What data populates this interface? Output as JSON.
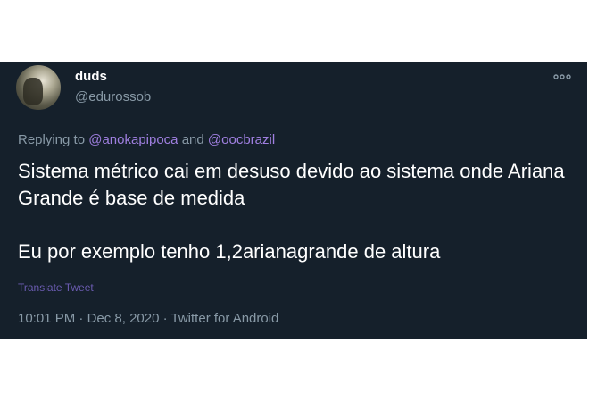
{
  "tweet": {
    "author": {
      "name": "duds",
      "handle": "@edurossob"
    },
    "more_icon": "ellipsis-icon",
    "replying": {
      "prefix": "Replying to ",
      "mention1": "@anokapipoca",
      "conjunction": " and ",
      "mention2": "@oocbrazil"
    },
    "text": {
      "paragraph1": "Sistema métrico cai em desuso devido ao sistema onde Ariana Grande é base de medida",
      "paragraph2": "Eu por exemplo tenho 1,2arianagrande de altura"
    },
    "translate_label": "Translate Tweet",
    "meta": {
      "time": "10:01 PM",
      "sep1": " · ",
      "date": "Dec 8, 2020",
      "sep2": " · ",
      "source": "Twitter for Android"
    }
  },
  "colors": {
    "background": "#15202b",
    "primary_text": "#ffffff",
    "secondary_text": "#8899a6",
    "mention": "#9f7fe0"
  }
}
